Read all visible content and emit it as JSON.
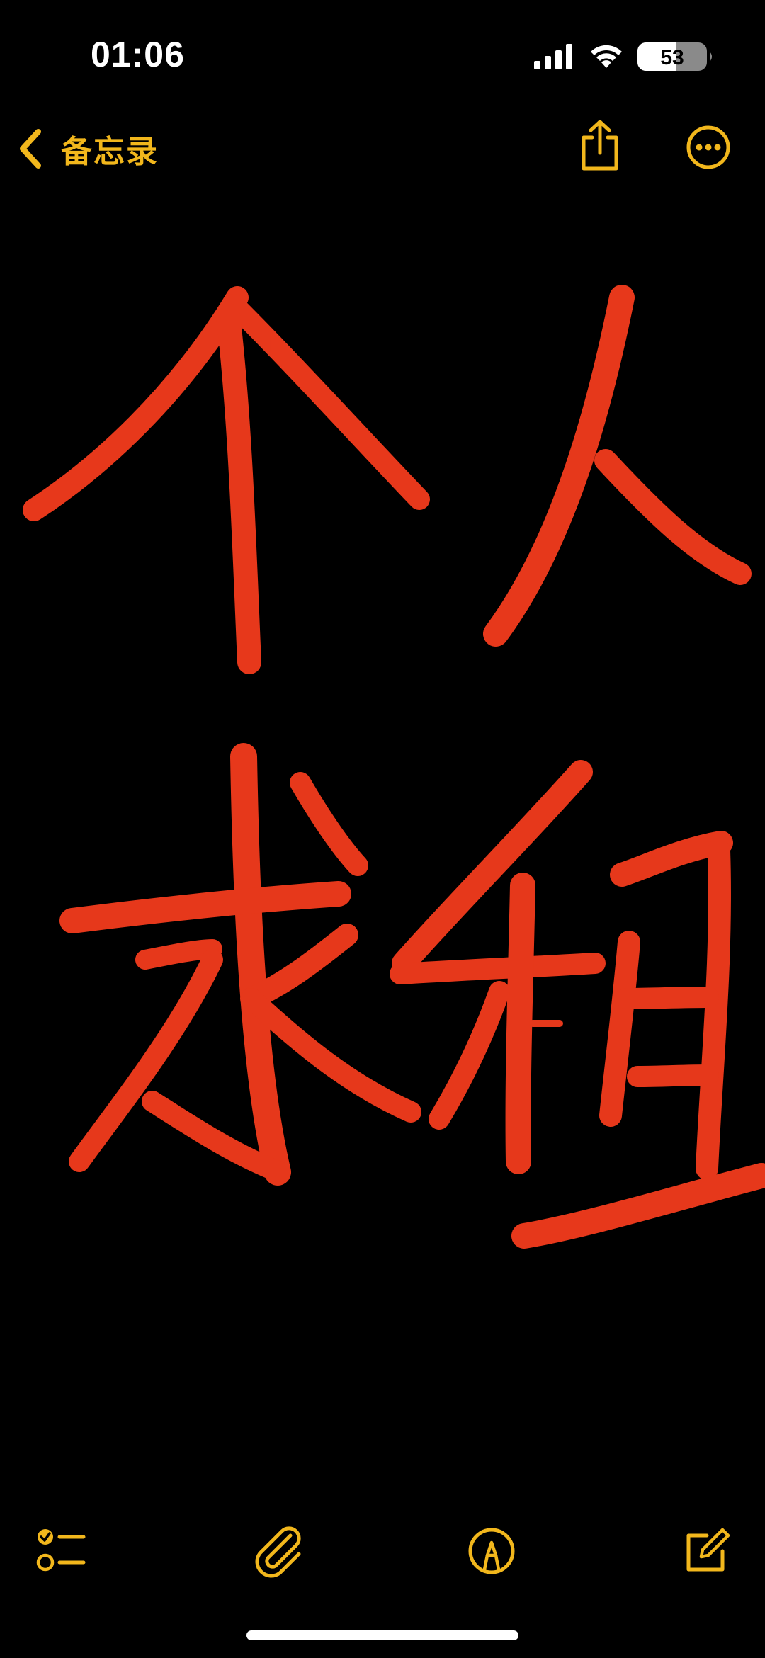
{
  "status_bar": {
    "time": "01:06",
    "battery_level": "53"
  },
  "nav": {
    "back_label": "备忘录",
    "back_icon": "chevron-left-icon",
    "share_icon": "share-icon",
    "more_icon": "ellipsis-circle-icon"
  },
  "toolbar": {
    "checklist_icon": "checklist-icon",
    "attachment_icon": "paperclip-icon",
    "markup_icon": "pen-tip-circle-icon",
    "compose_icon": "compose-icon"
  },
  "drawing": {
    "description_characters": [
      "个",
      "人",
      "求",
      "租"
    ],
    "stroke_color": "#EE3A1C"
  },
  "colors": {
    "accent": "#F2B71C",
    "background": "#000000"
  }
}
